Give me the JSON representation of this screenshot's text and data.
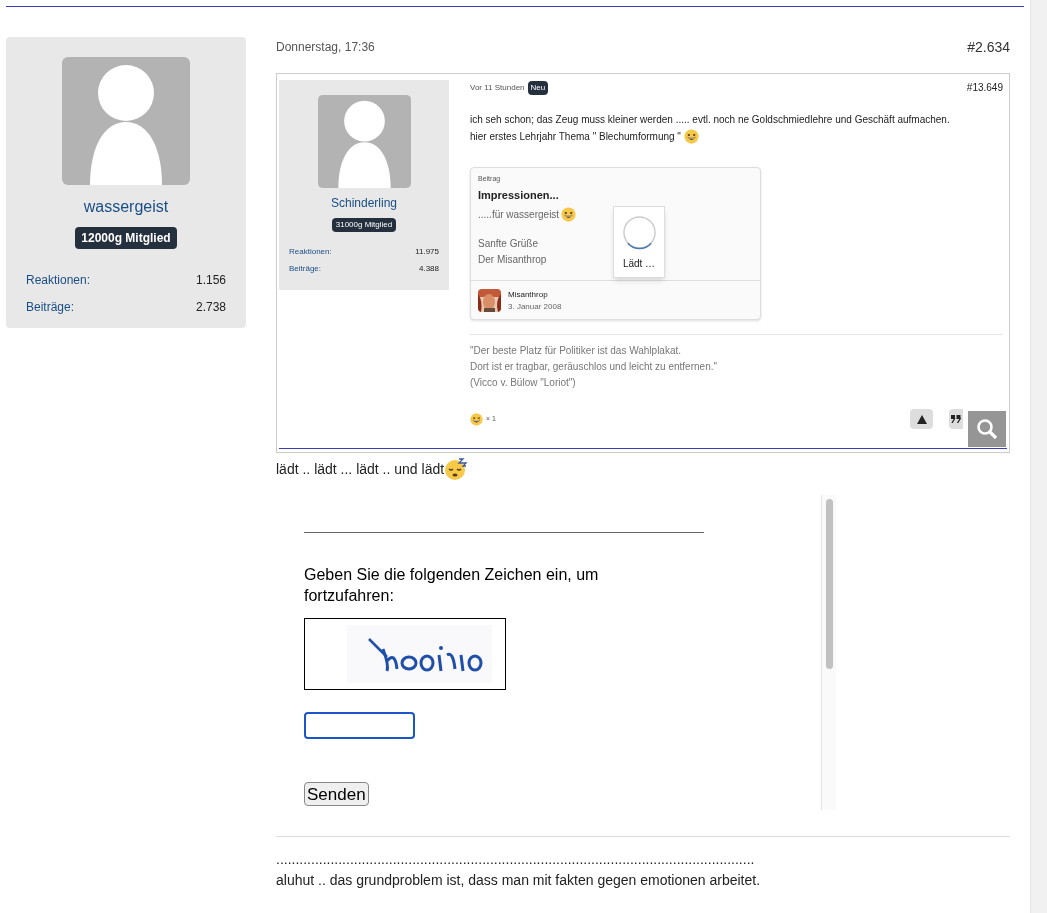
{
  "post": {
    "date": "Donnerstag, 17:36",
    "number": "#2.634",
    "author": {
      "name": "wassergeist",
      "badge": "12000g Mitglied",
      "stats": [
        {
          "label": "Reaktionen:",
          "value": "1.156"
        },
        {
          "label": "Beiträge:",
          "value": "2.738"
        }
      ]
    }
  },
  "quoted_screenshot": {
    "author": {
      "name": "Schinderling",
      "badge": "31000g Mitglied",
      "stats": [
        {
          "label": "Reaktionen:",
          "value": "11.975"
        },
        {
          "label": "Beiträge:",
          "value": "4.388"
        }
      ]
    },
    "time": "Vor 11 Stunden",
    "tag": "Neu",
    "number": "#13.649",
    "text_lines": [
      "ich seh schon; das Zeug muss kleiner werden ..... evtl. noch ne Goldschmiedlehre und Geschäft aufmachen.",
      "hier erstes Lehrjahr Thema \" Blechumformung \""
    ],
    "embed": {
      "label": "Beitrag",
      "title": "Impressionen...",
      "subtitle": ".....für wassergeist",
      "lines": [
        "Sanfte Grüße",
        "Der Misanthrop"
      ],
      "loading": "Lädt …",
      "author": "Misanthrop",
      "date": "3. Januar 2008"
    },
    "signature": [
      "\"Der beste Platz für Politiker ist das Wahlplakat.",
      "Dort ist er tragbar, geräuschlos und leicht zu entfernen.\"",
      "(Vicco v. Bülow \"Loriot\")"
    ],
    "reaction_count": "× 1"
  },
  "caption": "lädt .. lädt ... lädt .. und lädt",
  "captcha": {
    "prompt": "Geben Sie die folgenden Zeichen ein, um fortzufahren:",
    "button": "Senden"
  },
  "footer_lines": [
    "...........................................................................................................................",
    "aluhut .. das grundproblem ist, dass man mit fakten gegen emotionen arbeitet."
  ]
}
